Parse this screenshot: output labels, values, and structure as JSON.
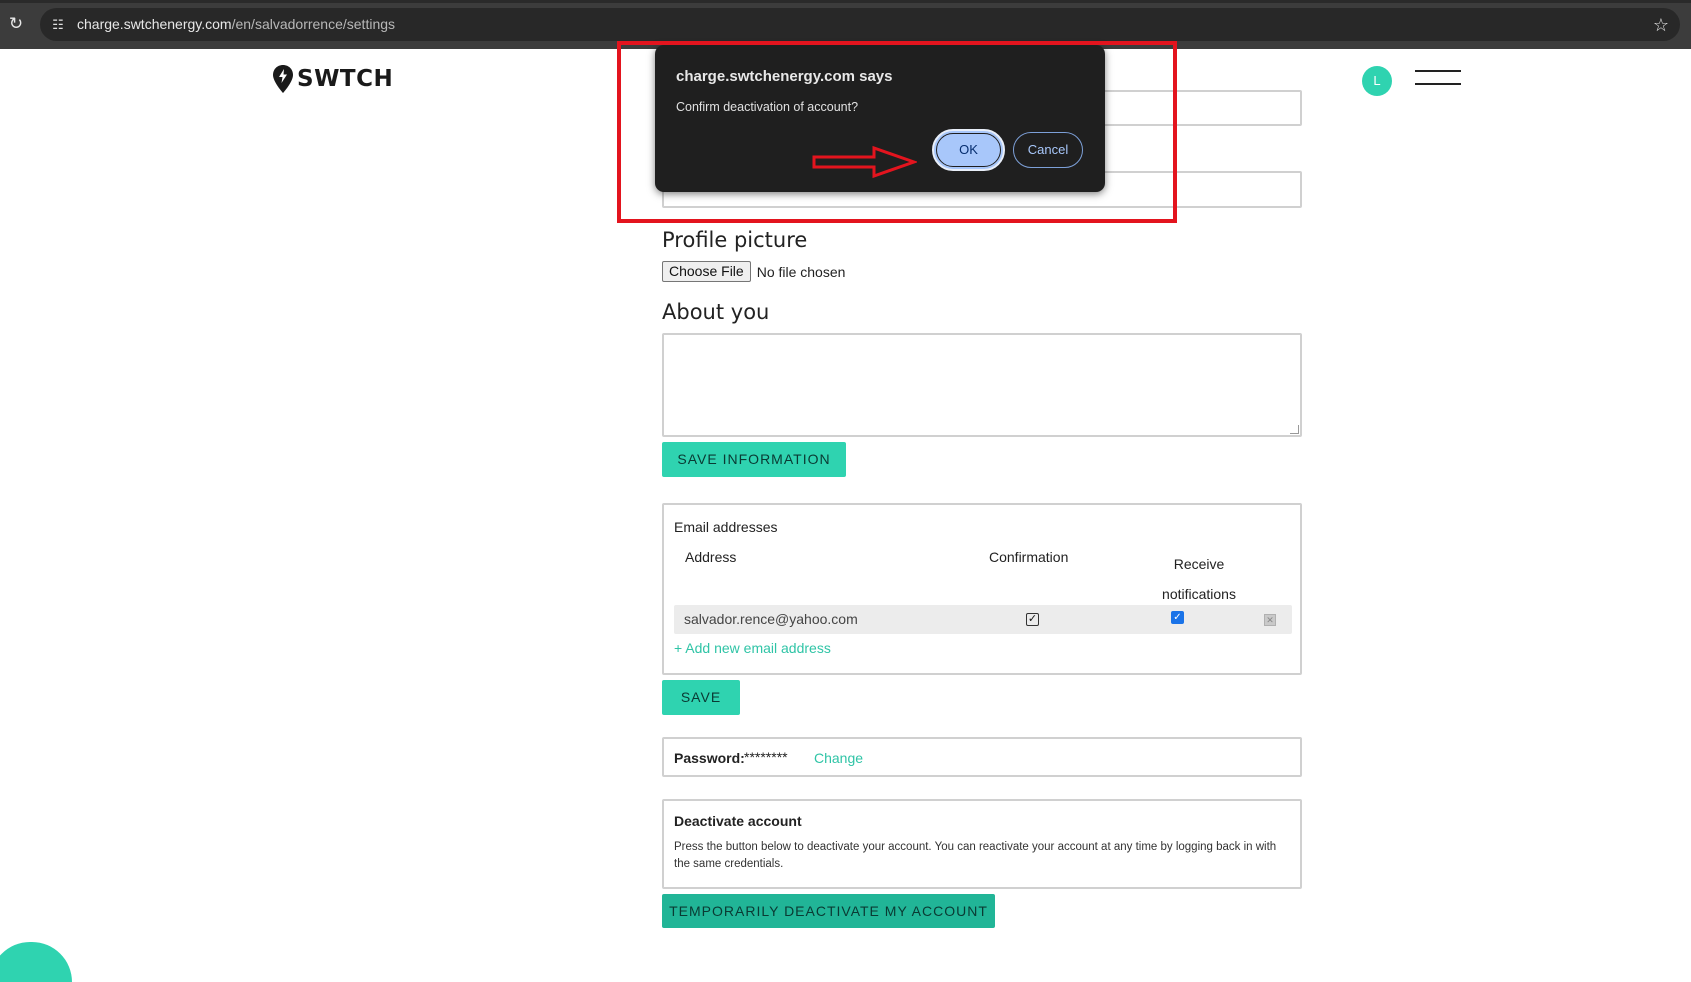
{
  "browser": {
    "url_host": "charge.swtchenergy.com",
    "url_path": "/en/salvadorrence/settings",
    "reload_icon": "reload-icon",
    "site_info_icon": "site-info-icon",
    "bookmark_icon": "star-icon"
  },
  "header": {
    "logo_text": "SWTCH",
    "avatar_initial": "L",
    "menu_icon": "hamburger-menu-icon"
  },
  "form": {
    "profile_picture_title": "Profile picture",
    "choose_file_label": "Choose File",
    "file_status": "No file chosen",
    "about_title": "About you",
    "about_value": "",
    "save_information_label": "SAVE INFORMATION"
  },
  "emails": {
    "title": "Email addresses",
    "col_address": "Address",
    "col_confirmation": "Confirmation",
    "col_receive_line1": "Receive",
    "col_receive_line2": "notifications",
    "rows": [
      {
        "address": "salvador.rence@yahoo.com",
        "confirmed": true,
        "receive_notifications": true
      }
    ],
    "add_link": "+ Add new email address",
    "save_label": "SAVE"
  },
  "password": {
    "label": "Password:",
    "value": "********",
    "change_link": "Change"
  },
  "deactivate": {
    "title": "Deactivate account",
    "description": "Press the button below to deactivate your account. You can reactivate your account at any time by logging back in with the same credentials.",
    "button_label": "TEMPORARILY DEACTIVATE MY ACCOUNT"
  },
  "dialog": {
    "title": "charge.swtchenergy.com says",
    "message": "Confirm deactivation of account?",
    "ok_label": "OK",
    "cancel_label": "Cancel"
  },
  "colors": {
    "accent": "#2fd3b0",
    "accent_dark": "#21b597",
    "annotation_red": "#e3141e",
    "dialog_bg": "#1f1f1f",
    "dialog_primary": "#a8c7fa"
  }
}
